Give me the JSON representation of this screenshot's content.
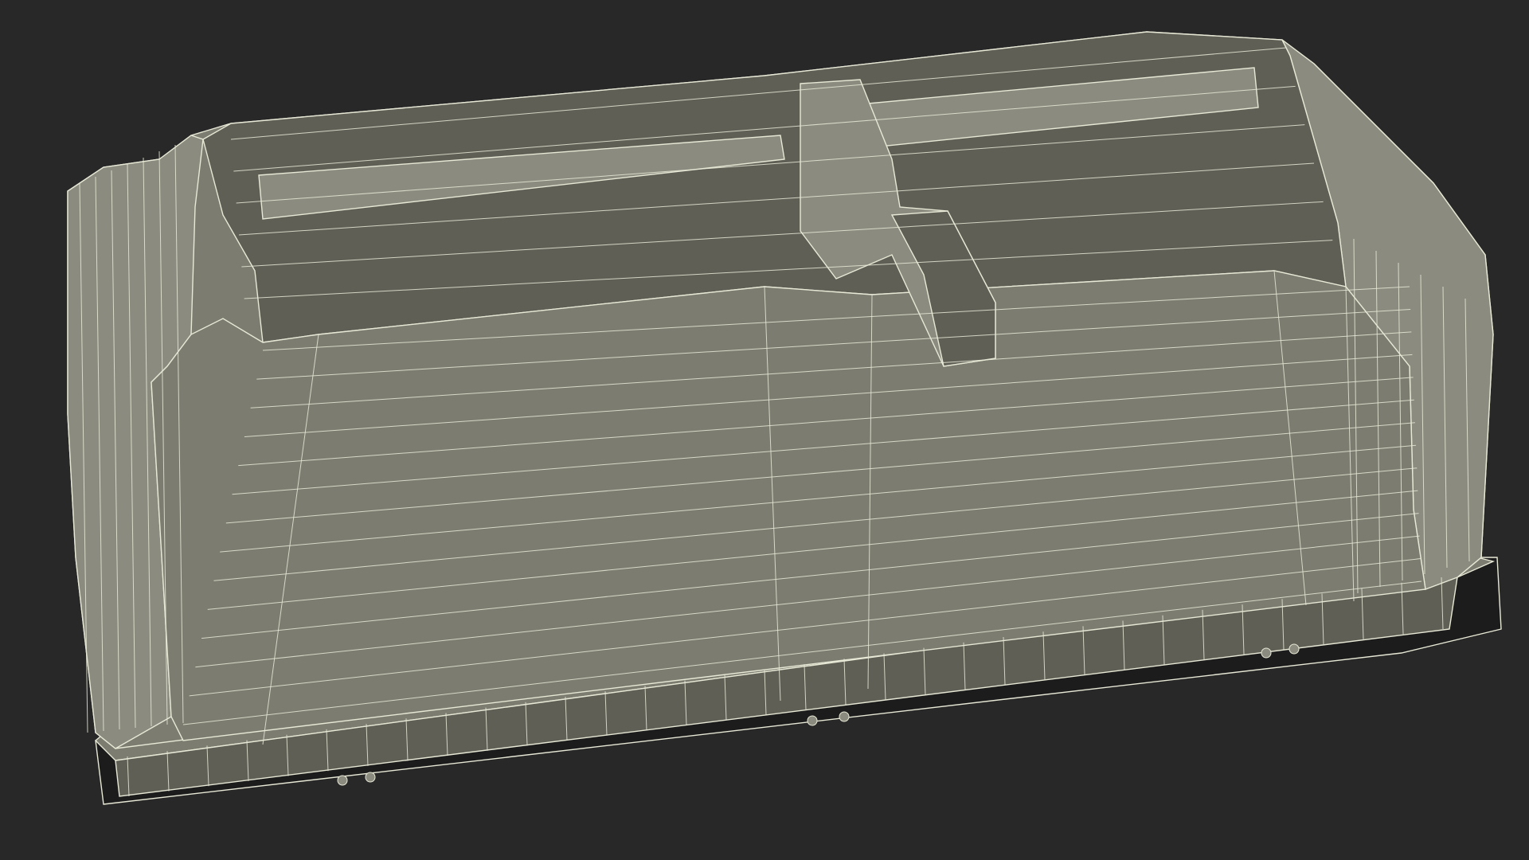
{
  "scene": {
    "subject": "wireframe-case",
    "colors": {
      "background": "#282828",
      "surface": "#7c7c70",
      "surface_light": "#8b8b7f",
      "surface_dark": "#5f5f56",
      "edge": "#e8e8d6",
      "shadow": "#1c1c1c"
    }
  }
}
